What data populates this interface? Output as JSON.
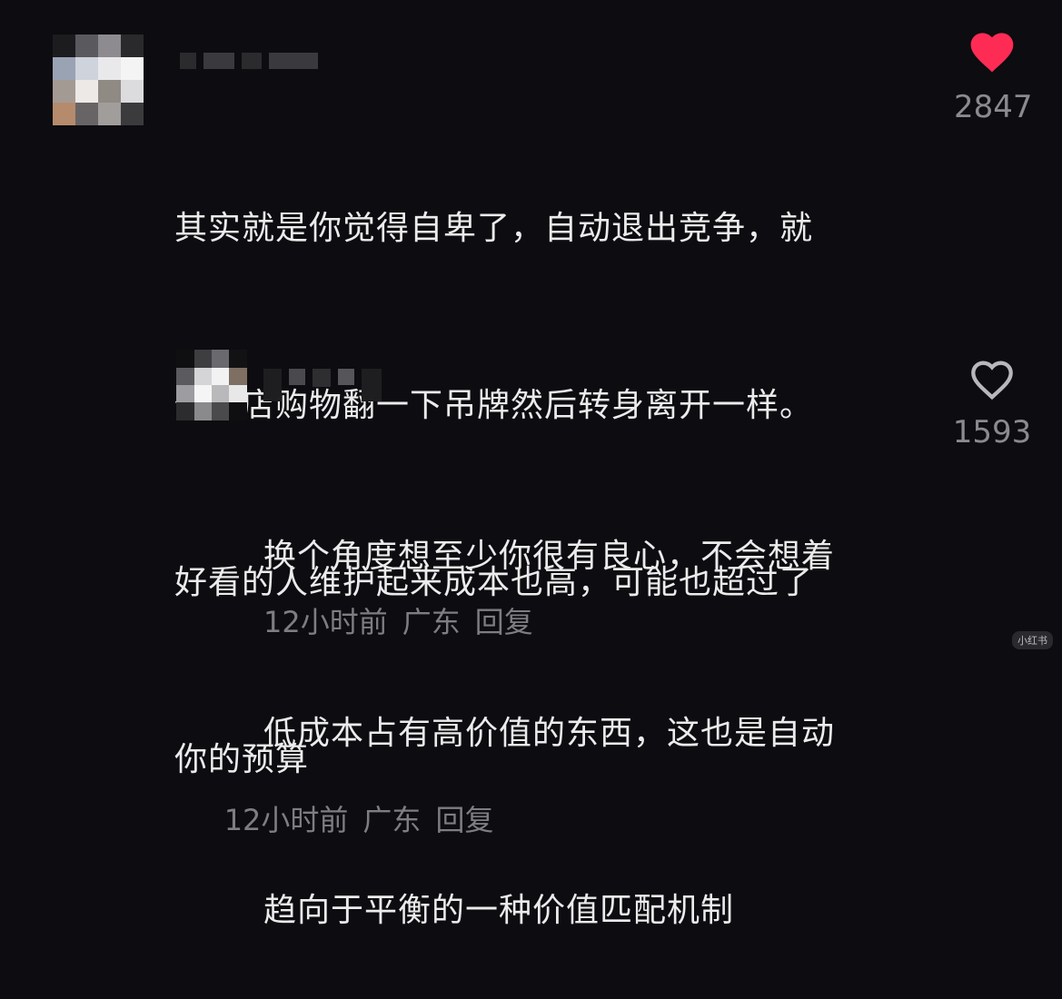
{
  "comments": [
    {
      "lines": [
        "其实就是你觉得自卑了，自动退出竞争，就",
        "像商店购物翻一下吊牌然后转身离开一样。",
        "好看的人维护起来成本也高，可能也超过了",
        "你的预算"
      ],
      "time": "12小时前",
      "location": "广东",
      "reply_label": "回复",
      "likes": "2847",
      "liked": true
    },
    {
      "lines": [
        "换个角度想至少你很有良心，不会想着",
        "低成本占有高价值的东西，这也是自动",
        "趋向于平衡的一种价值匹配机制"
      ],
      "time": "12小时前",
      "location": "广东",
      "reply_label": "回复",
      "likes": "1593",
      "liked": false
    }
  ],
  "colors": {
    "liked_heart": "#fe2c55",
    "unliked_heart": "#b8b8bc"
  },
  "watermark": "小红书"
}
